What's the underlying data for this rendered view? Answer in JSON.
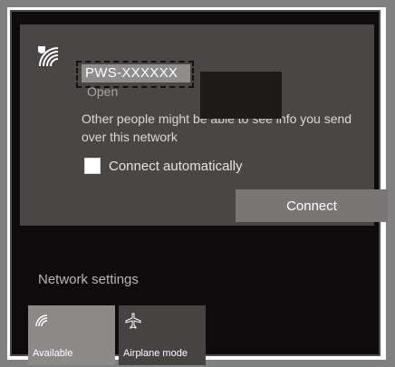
{
  "network": {
    "ssid": "PWS-XXXXXX",
    "status": "Open",
    "warning": "Other people might be able to see info you send over this network",
    "connect_auto_label": "Connect automatically",
    "connect_auto_checked": false,
    "connect_label": "Connect"
  },
  "footer": {
    "network_settings_label": "Network settings",
    "tiles": [
      {
        "label": "Available",
        "icon": "wifi-icon"
      },
      {
        "label": "Airplane mode",
        "icon": "airplane-icon"
      }
    ]
  }
}
